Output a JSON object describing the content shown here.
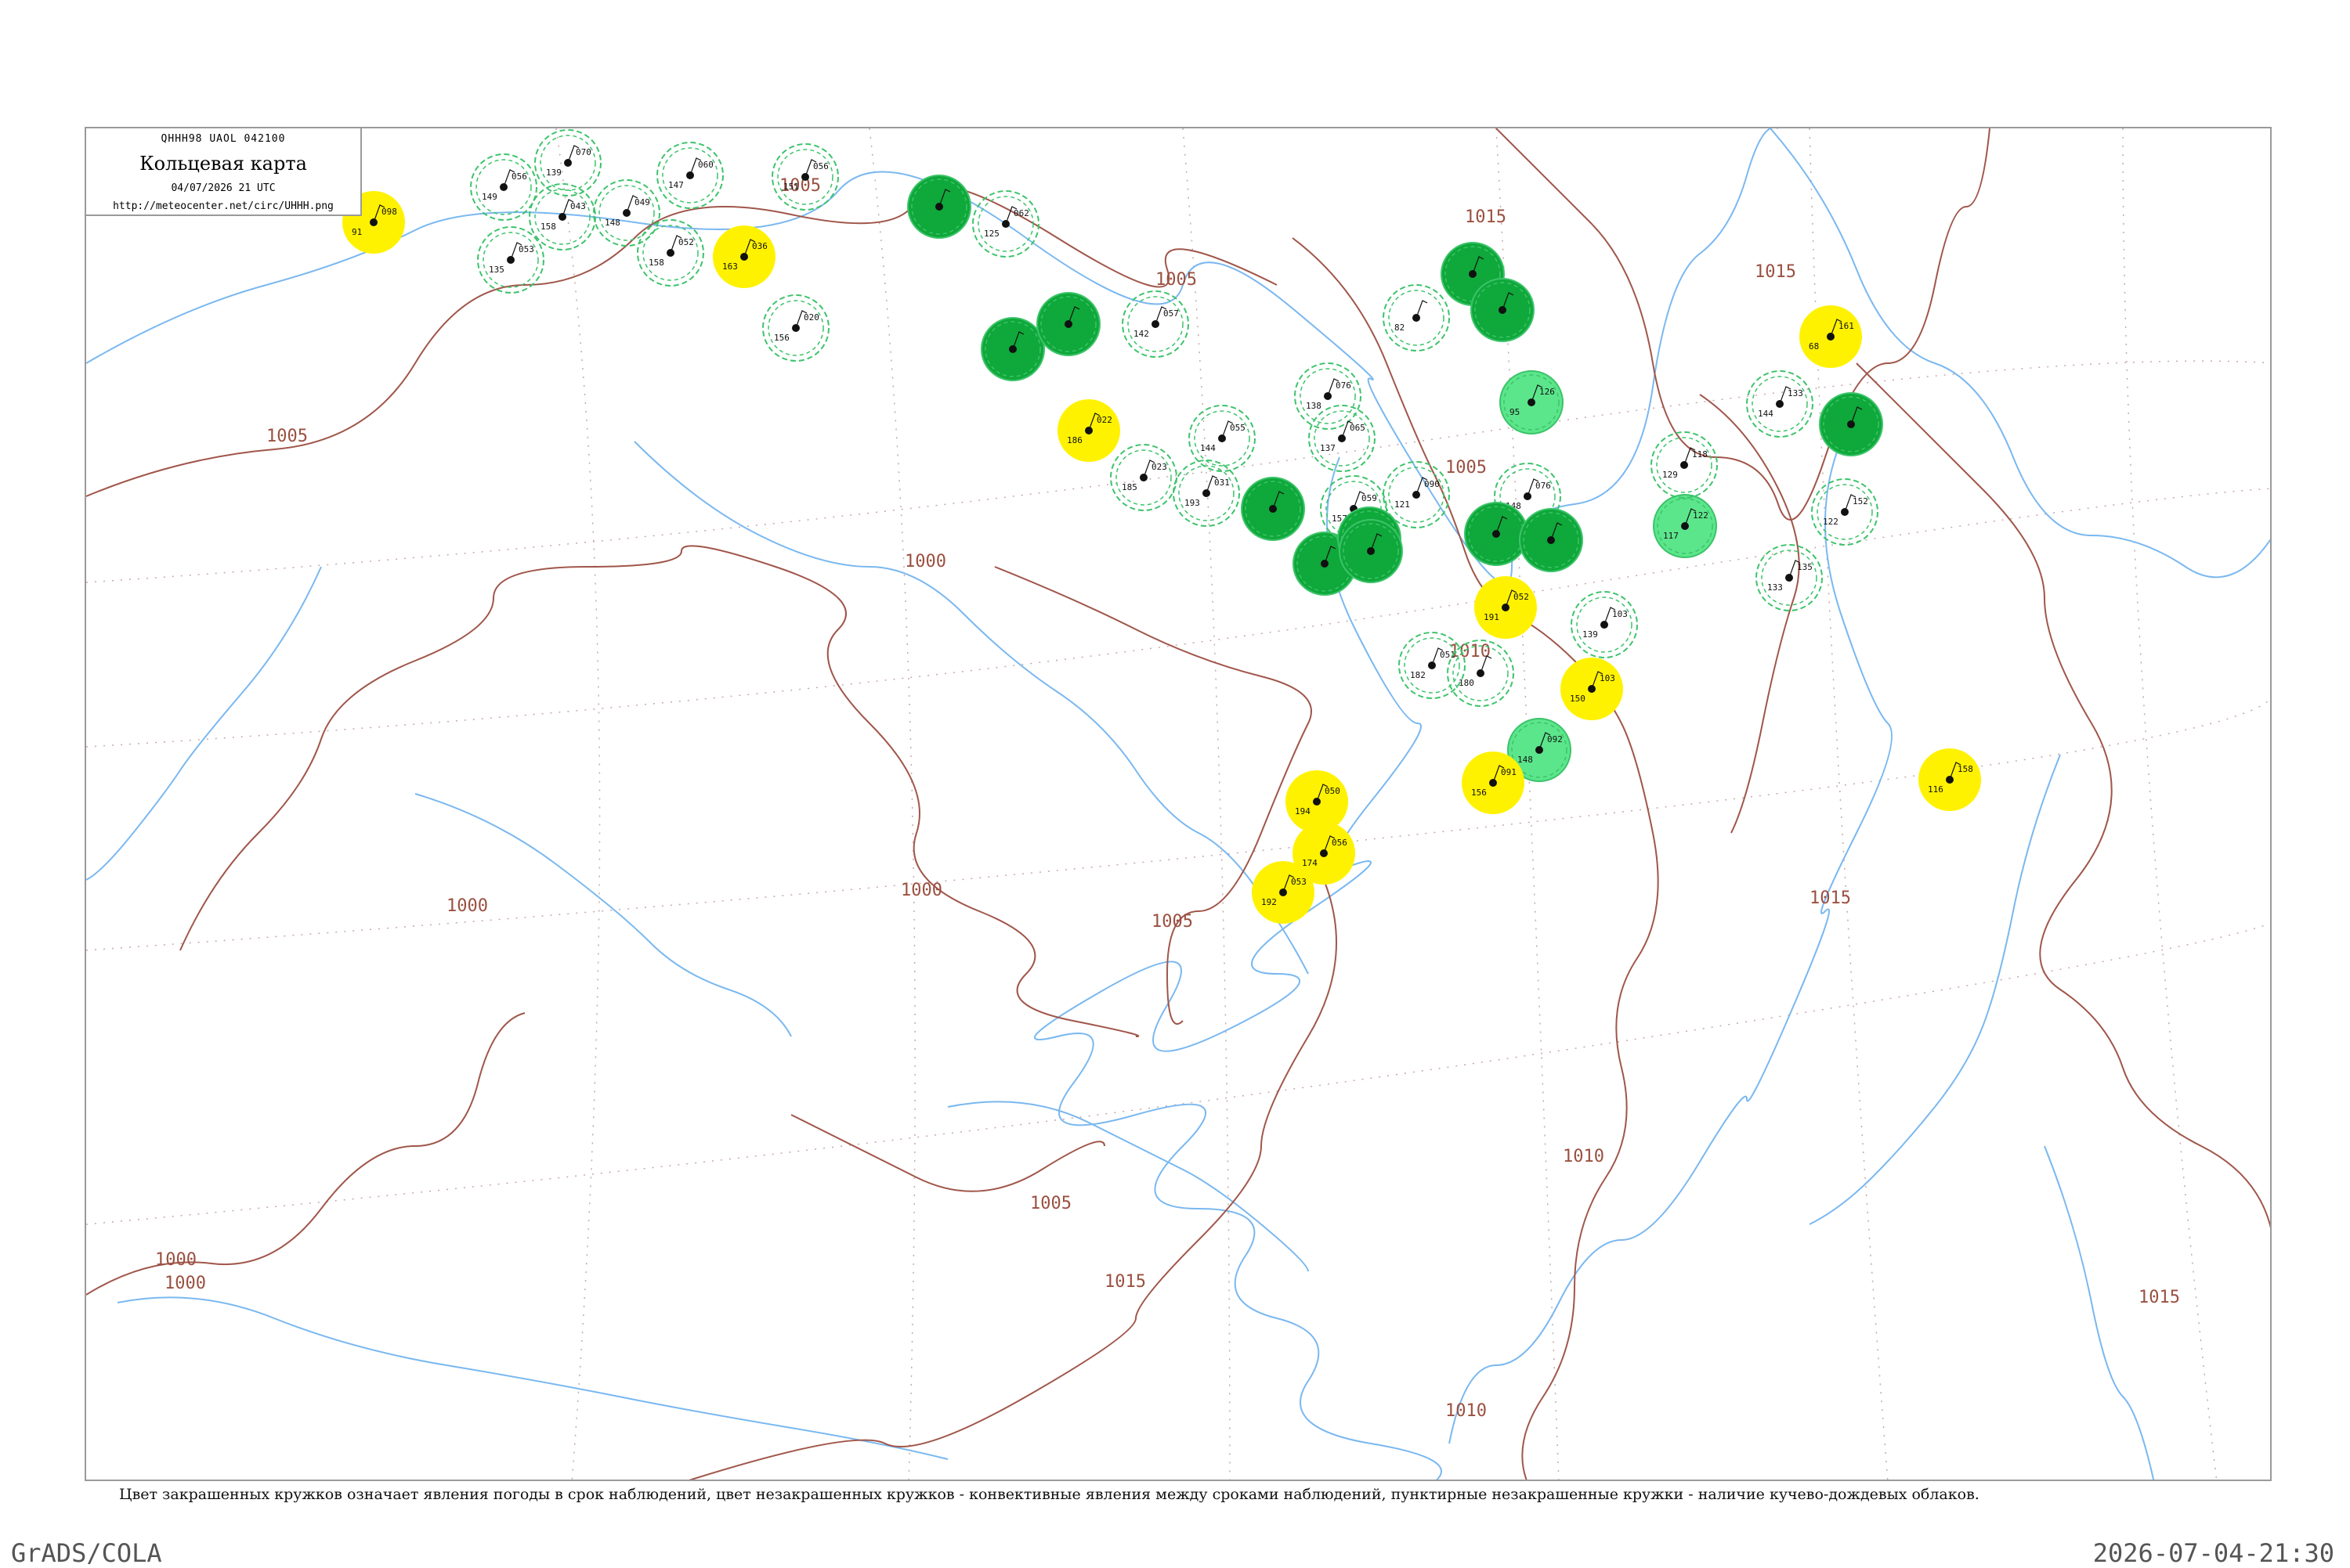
{
  "header": {
    "code": "QHHH98  UAOL  042100",
    "title": "Кольцевая карта",
    "datetime": "04/07/2026 21 UTC",
    "url": "http://meteocenter.net/circ/UHHH.png"
  },
  "caption": "Цвет закрашенных кружков означает явления погоды в срок наблюдений, цвет незакрашенных кружков - конвективные явления между сроками наблюдений, пунктирные незакрашенные кружки - наличие кучево-дождевых облаков.",
  "footer": {
    "left": "GrADS/COLA",
    "right": "2026-07-04-21:30"
  },
  "colors": {
    "isobar": "#a0564a",
    "coast": "#7ab8f0",
    "dark_green": "#0fa83a",
    "light_green": "#5ce68c",
    "yellow": "#fff200",
    "ring": "#3cc36a"
  },
  "isobar_labels": [
    "1005",
    "1005",
    "1005",
    "1000",
    "1000",
    "1000",
    "1005",
    "1005",
    "1000",
    "1000",
    "1005",
    "1010",
    "1010",
    "1015",
    "1015",
    "1015",
    "1010",
    "1015",
    "1015"
  ],
  "stations": [
    {
      "fill": "yellow",
      "t": "098",
      "p": "91"
    },
    {
      "fill": "ring",
      "t": "056",
      "p": "149"
    },
    {
      "fill": "ring",
      "t": "070",
      "p": "139"
    },
    {
      "fill": "ring",
      "t": "043",
      "p": "158"
    },
    {
      "fill": "ring",
      "t": "053",
      "p": "135"
    },
    {
      "fill": "ring",
      "t": "049",
      "p": "148"
    },
    {
      "fill": "ring",
      "t": "060",
      "p": "147"
    },
    {
      "fill": "ring",
      "t": "052",
      "p": "158"
    },
    {
      "fill": "yellow",
      "t": "036",
      "p": "163"
    },
    {
      "fill": "ring",
      "t": "056",
      "p": "151"
    },
    {
      "fill": "ring",
      "t": "020",
      "p": "156"
    },
    {
      "fill": "dark",
      "t": "",
      "p": ""
    },
    {
      "fill": "dark",
      "t": "",
      "p": ""
    },
    {
      "fill": "ring",
      "t": "062",
      "p": "125"
    },
    {
      "fill": "dark",
      "t": "",
      "p": ""
    },
    {
      "fill": "ring",
      "t": "057",
      "p": "142"
    },
    {
      "fill": "yellow",
      "t": "022",
      "p": "186"
    },
    {
      "fill": "ring",
      "t": "023",
      "p": "185"
    },
    {
      "fill": "ring",
      "t": "031",
      "p": "193"
    },
    {
      "fill": "ring",
      "t": "055",
      "p": "144"
    },
    {
      "fill": "ring",
      "t": "076",
      "p": "138"
    },
    {
      "fill": "ring",
      "t": "065",
      "p": "137"
    },
    {
      "fill": "dark",
      "t": "",
      "p": ""
    },
    {
      "fill": "dark",
      "t": "",
      "p": ""
    },
    {
      "fill": "ring",
      "t": "059",
      "p": "157"
    },
    {
      "fill": "dark",
      "t": "",
      "p": ""
    },
    {
      "fill": "dark",
      "t": "",
      "p": ""
    },
    {
      "fill": "ring",
      "t": "",
      "p": "82"
    },
    {
      "fill": "dark",
      "t": "",
      "p": ""
    },
    {
      "fill": "dark",
      "t": "",
      "p": ""
    },
    {
      "fill": "light",
      "t": "126",
      "p": "95"
    },
    {
      "fill": "ring",
      "t": "090",
      "p": "121"
    },
    {
      "fill": "ring",
      "t": "076",
      "p": "148"
    },
    {
      "fill": "dark",
      "t": "",
      "p": ""
    },
    {
      "fill": "dark",
      "t": "",
      "p": ""
    },
    {
      "fill": "yellow",
      "t": "052",
      "p": "191"
    },
    {
      "fill": "ring",
      "t": "103",
      "p": "139"
    },
    {
      "fill": "ring",
      "t": "051",
      "p": "182"
    },
    {
      "fill": "ring",
      "t": "",
      "p": "180"
    },
    {
      "fill": "yellow",
      "t": "103",
      "p": "150"
    },
    {
      "fill": "light",
      "t": "122",
      "p": "117"
    },
    {
      "fill": "ring",
      "t": "118",
      "p": "129"
    },
    {
      "fill": "ring",
      "t": "133",
      "p": "144"
    },
    {
      "fill": "dark",
      "t": "",
      "p": ""
    },
    {
      "fill": "ring",
      "t": "152",
      "p": "122"
    },
    {
      "fill": "yellow",
      "t": "161",
      "p": "68"
    },
    {
      "fill": "ring",
      "t": "135",
      "p": "133"
    },
    {
      "fill": "light",
      "t": "092",
      "p": "148"
    },
    {
      "fill": "yellow",
      "t": "091",
      "p": "156"
    },
    {
      "fill": "yellow",
      "t": "050",
      "p": "194"
    },
    {
      "fill": "yellow",
      "t": "056",
      "p": "174"
    },
    {
      "fill": "yellow",
      "t": "053",
      "p": "192"
    },
    {
      "fill": "yellow",
      "t": "158",
      "p": "116"
    }
  ]
}
